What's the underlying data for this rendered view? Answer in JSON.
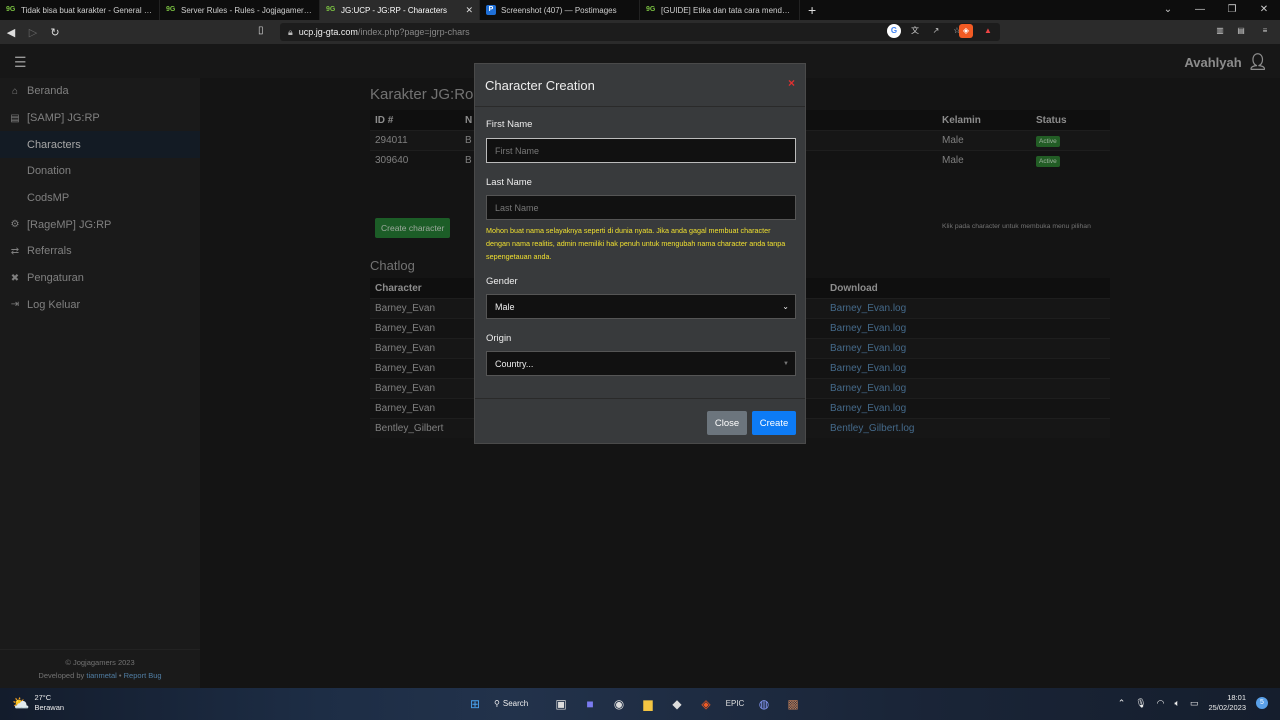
{
  "browser": {
    "tabs": [
      {
        "favicon": "jg-icon",
        "title": "Tidak bisa buat karakter - General Disc",
        "active": false
      },
      {
        "favicon": "jg-icon",
        "title": "Server Rules - Rules - Jogjagamers Co",
        "active": false
      },
      {
        "favicon": "jg-icon",
        "title": "JG:UCP - JG:RP - Characters",
        "active": true
      },
      {
        "favicon": "postimages-icon",
        "title": "Screenshot (407) — Postimages",
        "active": false
      },
      {
        "favicon": "jg-icon",
        "title": "[GUIDE] Etika dan tata cara mendatan",
        "active": false
      }
    ],
    "url_host": "ucp.jg-gta.com",
    "url_path": "/index.php?page=jgrp-chars"
  },
  "header": {
    "username": "Avahlyah"
  },
  "sidebar": {
    "items": [
      {
        "label": "Beranda",
        "icon": "home-icon"
      },
      {
        "label": "[SAMP] JG:RP",
        "icon": "samp-icon"
      },
      {
        "label": "Characters",
        "icon": "",
        "sub": true,
        "active": true
      },
      {
        "label": "Donation",
        "icon": "",
        "sub": true
      },
      {
        "label": "CodsMP",
        "icon": "",
        "sub": true
      },
      {
        "label": "[RageMP] JG:RP",
        "icon": "ragemp-icon"
      },
      {
        "label": "Referrals",
        "icon": "referrals-icon"
      },
      {
        "label": "Pengaturan",
        "icon": "settings-icon"
      },
      {
        "label": "Log Keluar",
        "icon": "logout-icon"
      }
    ],
    "footer_line1": "© Jogjagamers 2023",
    "footer_line2_prefix": "Developed by",
    "footer_dev": "tianmetal",
    "footer_sep": "•",
    "footer_report": "Report Bug"
  },
  "characters": {
    "title": "Karakter JG:Roleplay",
    "headers": {
      "id": "ID #",
      "name": "N",
      "gender": "Kelamin",
      "status": "Status"
    },
    "rows": [
      {
        "id": "294011",
        "name": "B",
        "gender": "Male",
        "status": "Active"
      },
      {
        "id": "309640",
        "name": "B",
        "gender": "Male",
        "status": "Active"
      }
    ],
    "create_button": "Create character",
    "hint": "Klik pada character untuk membuka menu pilihan"
  },
  "chatlog": {
    "title": "Chatlog",
    "headers": {
      "character": "Character",
      "download": "Download"
    },
    "rows": [
      {
        "character": "Barney_Evan",
        "download": "Barney_Evan.log"
      },
      {
        "character": "Barney_Evan",
        "download": "Barney_Evan.log"
      },
      {
        "character": "Barney_Evan",
        "download": "Barney_Evan.log"
      },
      {
        "character": "Barney_Evan",
        "download": "Barney_Evan.log"
      },
      {
        "character": "Barney_Evan",
        "download": "Barney_Evan.log"
      },
      {
        "character": "Barney_Evan",
        "download": "Barney_Evan.log"
      },
      {
        "character": "Bentley_Gilbert",
        "download": "Bentley_Gilbert.log"
      }
    ]
  },
  "modal": {
    "title": "Character Creation",
    "close_symbol": "×",
    "first_name_label": "First Name",
    "first_name_placeholder": "First Name",
    "first_name_value": "",
    "last_name_label": "Last Name",
    "last_name_placeholder": "Last Name",
    "last_name_value": "",
    "warning": "Mohon buat nama selayaknya seperti di dunia nyata. Jika anda gagal membuat character dengan nama realitis, admin memiliki hak penuh untuk mengubah nama character anda tanpa sepengetauan anda.",
    "gender_label": "Gender",
    "gender_value": "Male",
    "origin_label": "Origin",
    "origin_placeholder": "Country...",
    "close_button": "Close",
    "create_button": "Create",
    "colors": {
      "close_icon": "#e03030",
      "create": "#0d7bf5",
      "close": "#6c757d",
      "warning": "#f0e030"
    }
  },
  "taskbar": {
    "temperature": "27°C",
    "weather": "Berawan",
    "search_label": "Search",
    "time": "18:01",
    "date": "25/02/2023",
    "notifications": "5"
  }
}
